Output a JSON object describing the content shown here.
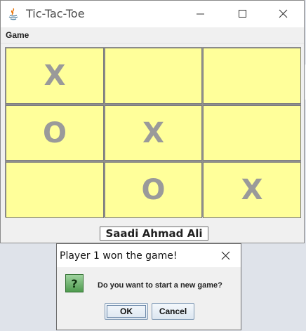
{
  "window": {
    "title": "Tic-Tac-Toe",
    "menu": {
      "game_label": "Game"
    }
  },
  "board": {
    "cells": [
      "X",
      "",
      "",
      "O",
      "X",
      "",
      "",
      "O",
      "X"
    ]
  },
  "player_name": "Saadi Ahmad Ali",
  "dialog": {
    "title": "Player 1 won the game!",
    "icon_glyph": "?",
    "message": "Do you want to start a new game?",
    "ok_label": "OK",
    "cancel_label": "Cancel"
  },
  "colors": {
    "cell_background": "#ffff9a",
    "mark_color": "#9a9a9a",
    "question_icon": "#4e9a4e"
  }
}
